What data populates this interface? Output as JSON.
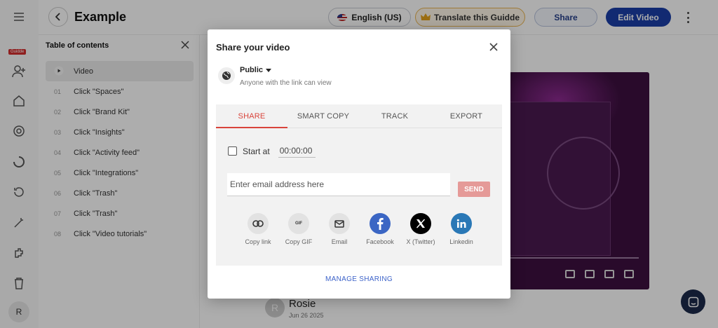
{
  "app": {
    "title": "Example",
    "badge": "Guidde",
    "avatar_initial": "R"
  },
  "header": {
    "language": "English (US)",
    "translate": "Translate this Guidde",
    "share": "Share",
    "edit": "Edit Video"
  },
  "toc": {
    "title": "Table of contents",
    "items": [
      {
        "num": "",
        "label": "Video"
      },
      {
        "num": "01",
        "label": "Click \"Spaces\""
      },
      {
        "num": "02",
        "label": "Click \"Brand Kit\""
      },
      {
        "num": "03",
        "label": "Click \"Insights\""
      },
      {
        "num": "04",
        "label": "Click \"Activity feed\""
      },
      {
        "num": "05",
        "label": "Click \"Integrations\""
      },
      {
        "num": "06",
        "label": "Click \"Trash\""
      },
      {
        "num": "07",
        "label": "Click \"Trash\""
      },
      {
        "num": "08",
        "label": "Click \"Video tutorials\""
      }
    ]
  },
  "comment": {
    "initial": "R",
    "name": "Rosie",
    "date": "Jun 26 2025"
  },
  "modal": {
    "title": "Share your video",
    "visibility": "Public",
    "visibility_hint": "Anyone with the link can view",
    "tabs": [
      "SHARE",
      "SMART COPY",
      "TRACK",
      "EXPORT"
    ],
    "active_tab": 0,
    "start_at_label": "Start at",
    "start_at_value": "00:00:00",
    "email_placeholder": "Enter email address here",
    "send": "SEND",
    "share_options": [
      {
        "label": "Copy link",
        "icon": "link-icon"
      },
      {
        "label": "Copy GIF",
        "icon": "gif-icon",
        "glyph": "GIF"
      },
      {
        "label": "Email",
        "icon": "email-icon"
      },
      {
        "label": "Facebook",
        "icon": "facebook-icon",
        "color": "#3b66c4"
      },
      {
        "label": "X (Twitter)",
        "icon": "x-icon",
        "color": "#000000"
      },
      {
        "label": "Linkedin",
        "icon": "linkedin-icon",
        "color": "#2a78b6"
      }
    ],
    "manage": "MANAGE SHARING"
  },
  "colors": {
    "accent_red": "#d9443b",
    "primary_blue": "#1b3fa8",
    "link_blue": "#3d63c9"
  }
}
